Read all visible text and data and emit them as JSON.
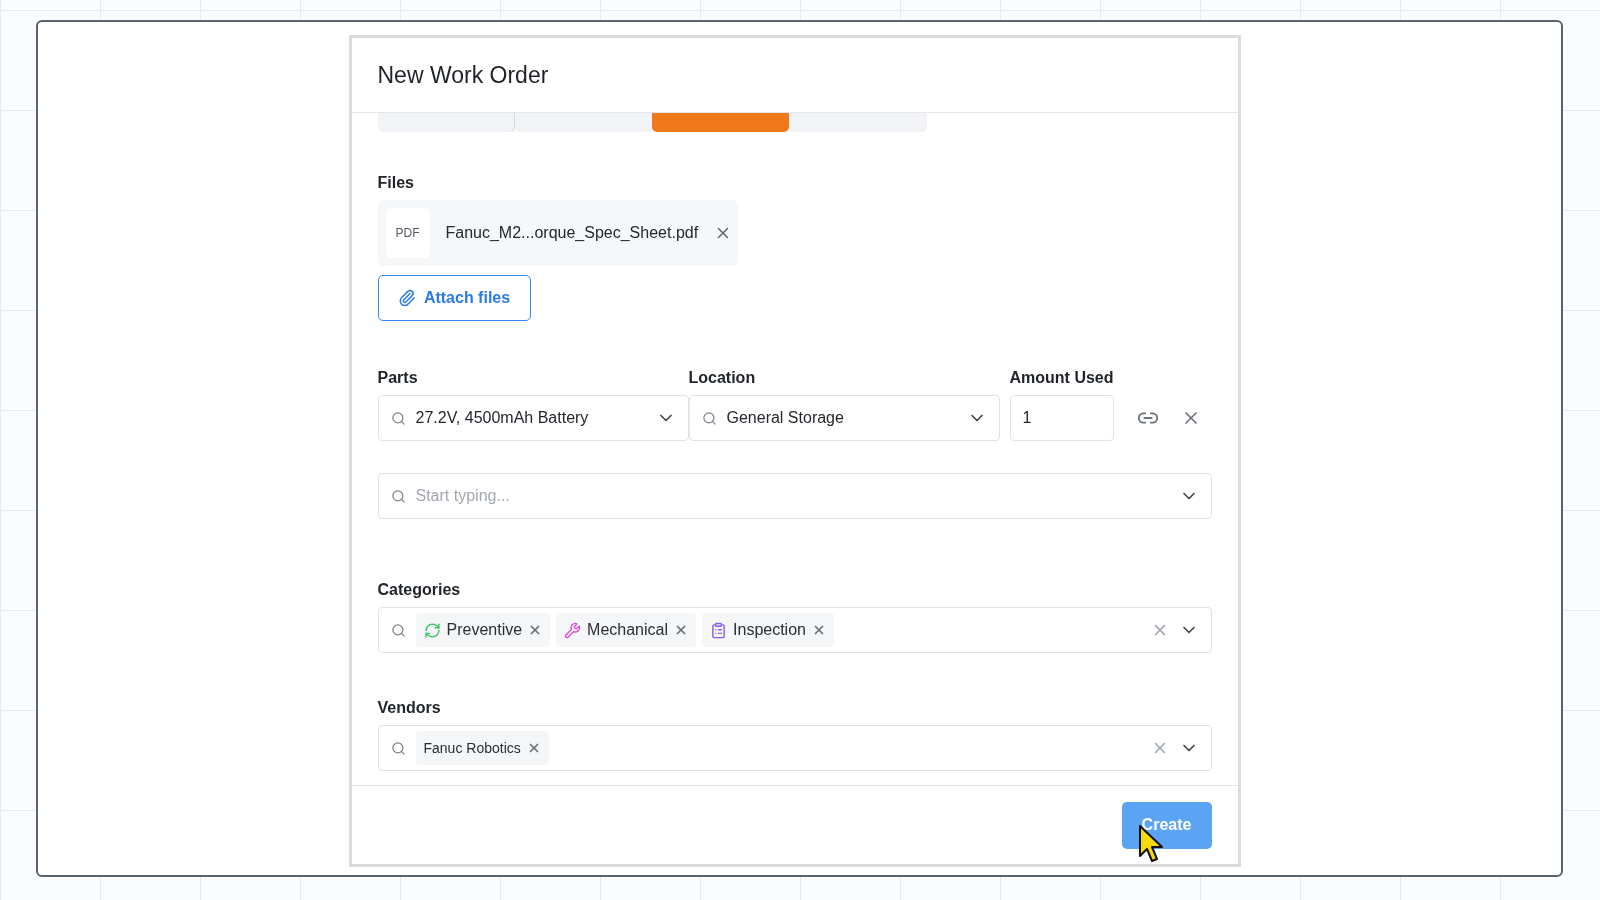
{
  "window": {
    "title": "New Work Order"
  },
  "priority": {
    "options": [
      {
        "selected": false
      },
      {
        "selected": false
      },
      {
        "selected": true
      },
      {
        "selected": false
      }
    ]
  },
  "files": {
    "label": "Files",
    "items": [
      {
        "type": "PDF",
        "name": "Fanuc_M2...orque_Spec_Sheet.pdf"
      }
    ],
    "attach_button": "Attach files"
  },
  "parts": {
    "columns": [
      "Parts",
      "Location",
      "Amount Used"
    ],
    "rows": [
      {
        "part": "27.2V, 4500mAh Battery",
        "location": "General Storage",
        "amount": "1"
      }
    ],
    "new_row": {
      "placeholder": "Start typing..."
    }
  },
  "categories": {
    "label": "Categories",
    "tags": [
      {
        "label": "Preventive",
        "kind": "refresh",
        "color": "#3cc36a"
      },
      {
        "label": "Mechanical",
        "kind": "wrench",
        "color": "#d94fd6"
      },
      {
        "label": "Inspection",
        "kind": "clipboard",
        "color": "#8b5cf6"
      }
    ]
  },
  "vendors": {
    "label": "Vendors",
    "tags": [
      {
        "label": "Fanuc Robotics"
      }
    ]
  },
  "footer": {
    "create_button": "Create"
  }
}
